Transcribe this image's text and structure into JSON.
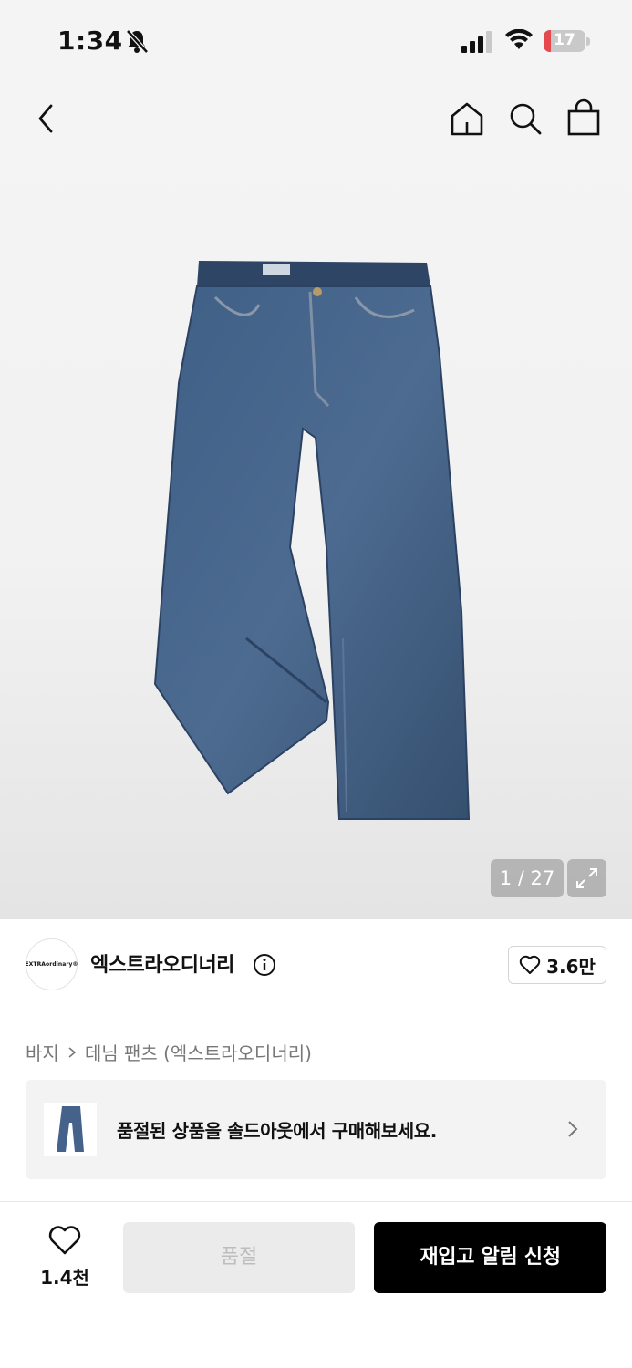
{
  "status_bar": {
    "time": "1:34",
    "battery_percent": "17",
    "battery_level": 0.17,
    "icons": [
      "bell-slash-icon",
      "cellular-signal-icon",
      "wifi-icon",
      "battery-icon"
    ]
  },
  "nav": {
    "icons": [
      "back-chevron-icon",
      "home-icon",
      "search-icon",
      "shopping-bag-icon"
    ]
  },
  "gallery": {
    "counter": "1 / 27",
    "expand_icon": "expand-arrows-icon"
  },
  "brand": {
    "logo_text": "EXTRAordinary®",
    "name": "엑스트라오디너리",
    "like_count": "3.6만"
  },
  "breadcrumb": {
    "category": "바지",
    "subcategory": "데님 팬츠 (엑스트라오디너리)"
  },
  "soldout_banner": {
    "text": "품절된 상품을 솔드아웃에서 구매해보세요."
  },
  "bottom_bar": {
    "wish_count": "1.4천",
    "soldout_label": "품절",
    "notify_label": "재입고 알림 신청"
  },
  "colors": {
    "accent_black": "#000000",
    "battery_red": "#e5484d",
    "soldout_bg": "#ebebeb"
  }
}
